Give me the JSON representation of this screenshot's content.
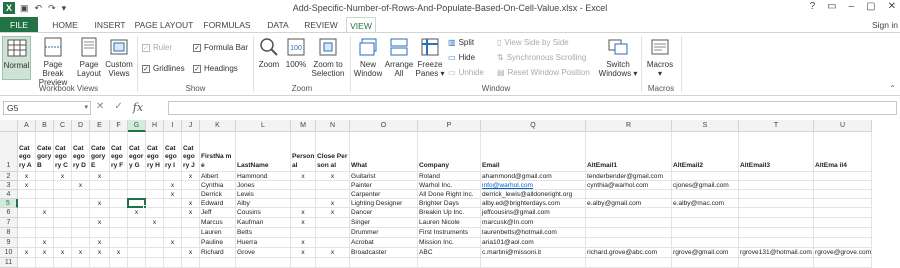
{
  "window": {
    "title": "Add-Specific-Number-of-Rows-And-Populate-Based-On-Cell-Value.xlsx - Excel",
    "logo": "X",
    "qat_icons": [
      "save-icon",
      "undo-icon",
      "redo-icon",
      "customize-icon"
    ],
    "controls": [
      "?",
      "▭",
      "–",
      "▢",
      "✕"
    ]
  },
  "tabs": [
    {
      "label": "FILE"
    },
    {
      "label": "HOME"
    },
    {
      "label": "INSERT"
    },
    {
      "label": "PAGE LAYOUT"
    },
    {
      "label": "FORMULAS"
    },
    {
      "label": "DATA"
    },
    {
      "label": "REVIEW"
    },
    {
      "label": "VIEW"
    }
  ],
  "signin": "Sign in",
  "ribbon": {
    "workbook_views": {
      "label": "Workbook Views",
      "normal": "Normal",
      "page_break_1": "Page Break",
      "page_break_2": "Preview",
      "page_layout_1": "Page",
      "page_layout_2": "Layout",
      "custom_views_1": "Custom",
      "custom_views_2": "Views"
    },
    "show": {
      "label": "Show",
      "ruler": "Ruler",
      "gridlines": "Gridlines",
      "formula_bar": "Formula Bar",
      "headings": "Headings"
    },
    "zoom": {
      "label": "Zoom",
      "zoom": "Zoom",
      "hundred": "100%",
      "zoom_sel_1": "Zoom to",
      "zoom_sel_2": "Selection"
    },
    "window": {
      "label": "Window",
      "new_1": "New",
      "new_2": "Window",
      "arrange_1": "Arrange",
      "arrange_2": "All",
      "freeze_1": "Freeze",
      "freeze_2": "Panes ▾",
      "split": "Split",
      "hide": "Hide",
      "unhide": "Unhide",
      "side_by_side": "View Side by Side",
      "sync_scroll": "Synchronous Scrolling",
      "reset_pos": "Reset Window Position",
      "switch_1": "Switch",
      "switch_2": "Windows ▾"
    },
    "macros": {
      "label": "Macros",
      "macros_1": "Macros",
      "macros_2": "▾"
    }
  },
  "formula_bar": {
    "name_box": "G5",
    "fx": "fx",
    "cancel": "✕",
    "enter": "✓",
    "value": ""
  },
  "sheet": {
    "columns": [
      "A",
      "B",
      "C",
      "D",
      "E",
      "F",
      "G",
      "H",
      "I",
      "J",
      "K",
      "L",
      "M",
      "N",
      "O",
      "P",
      "Q",
      "R",
      "S",
      "T",
      "U"
    ],
    "rows": [
      "1",
      "2",
      "3",
      "4",
      "5",
      "6",
      "7",
      "8",
      "9",
      "10",
      "11"
    ],
    "selected_col": "G",
    "selected_row": "5",
    "headers": [
      "Category A",
      "Category B",
      "Category C",
      "Category D",
      "Category E",
      "Category F",
      "Category G",
      "Category H",
      "Category I",
      "Category J",
      "FirstName",
      "LastName",
      "Personal",
      "Close Personal",
      "What",
      "Company",
      "Email",
      "AltEmail1",
      "AltEmail2",
      "AltEmail3",
      "AltEmail4"
    ],
    "header_display": [
      "Cat ego ry A",
      "Cate gory B",
      "Cat ego ry C",
      "Cat ego ry D",
      "Cate gory E",
      "Cat ego ry F",
      "Cat egor y G",
      "Cat ego ry H",
      "Cat ego ry I",
      "Cat ego ry J",
      "FirstNa me",
      "LastName",
      "Person al",
      "Close Person al",
      "What",
      "Company",
      "Email",
      "AltEmail1",
      "AltEmail2",
      "AltEmail3",
      "AltEma il4"
    ],
    "data": [
      [
        "x",
        "",
        "x",
        "",
        "x",
        "",
        "",
        "",
        "",
        "x",
        "Albert",
        "Hammond",
        "x",
        "x",
        "Guitarist",
        "Roland",
        "ahammond@gmail.com",
        "tenderbender@gmail.com",
        "",
        "",
        ""
      ],
      [
        "x",
        "",
        "",
        "x",
        "",
        "",
        "",
        "",
        "x",
        "",
        "Cynthia",
        "Jones",
        "",
        "",
        "Painter",
        "Warhol Inc.",
        "info@warhol.com",
        "cynthia@warhol.com",
        "cjones@gmail.com",
        "",
        ""
      ],
      [
        "",
        "",
        "",
        "",
        "",
        "",
        "",
        "",
        "x",
        "",
        "Derrick",
        "Lewis",
        "",
        "",
        "Carpenter",
        "All Done Right Inc.",
        "derrick_lewis@alldoneright.org",
        "",
        "",
        "",
        ""
      ],
      [
        "",
        "",
        "",
        "",
        "x",
        "",
        "",
        "",
        "",
        "x",
        "Edward",
        "Alby",
        "",
        "x",
        "Lighting Designer",
        "Brighter Days",
        "alby.ed@brighterdays.com",
        "e.alby@gmail.com",
        "e.alby@mac.com",
        "",
        ""
      ],
      [
        "",
        "x",
        "",
        "",
        "",
        "",
        "x",
        "",
        "",
        "x",
        "Jeff",
        "Cousins",
        "x",
        "x",
        "Dancer",
        "Breakin Up Inc.",
        "jeffcousins@gmail.com",
        "",
        "",
        "",
        ""
      ],
      [
        "",
        "",
        "",
        "",
        "x",
        "",
        "",
        "x",
        "",
        "",
        "Marcus",
        "Kaufman",
        "x",
        "",
        "Singer",
        "Lauren Nicole",
        "marcusk@In.com",
        "",
        "",
        "",
        ""
      ],
      [
        "",
        "",
        "",
        "",
        "",
        "",
        "",
        "",
        "",
        "",
        "Lauren",
        "Betts",
        "",
        "",
        "Drummer",
        "First Instruments",
        "laurenbetts@hotmail.com",
        "",
        "",
        "",
        ""
      ],
      [
        "",
        "x",
        "",
        "",
        "x",
        "",
        "",
        "",
        "x",
        "",
        "Pauline",
        "Huerra",
        "x",
        "",
        "Acrobat",
        "Mission Inc.",
        "aria101@aol.com",
        "",
        "",
        "",
        ""
      ],
      [
        "x",
        "x",
        "x",
        "x",
        "x",
        "x",
        "",
        "",
        "",
        "x",
        "Richard",
        "Grove",
        "x",
        "x",
        "Broadcaster",
        "ABC",
        "c.martini@missoni.it",
        "richard.grove@abc.com",
        "rgrove@gmail.com",
        "rgrove131@hotmail.com",
        "rgrove@grove.com"
      ],
      [
        "",
        "",
        "",
        "",
        "",
        "",
        "",
        "",
        "",
        "",
        "",
        "",
        "",
        "",
        "",
        "",
        "",
        "",
        "",
        "",
        ""
      ]
    ]
  }
}
